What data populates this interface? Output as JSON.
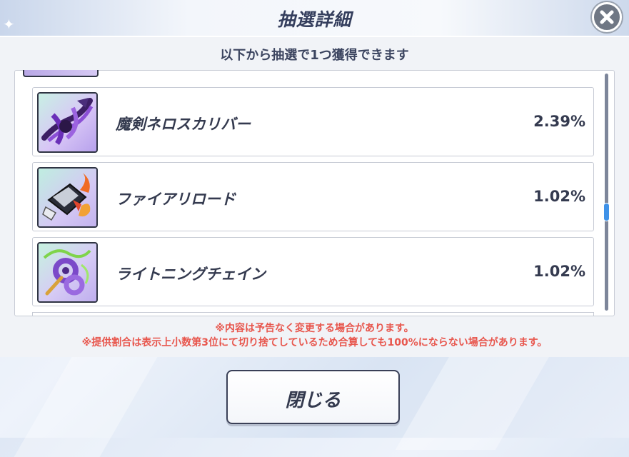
{
  "window": {
    "title": "抽選詳細",
    "close_icon": "close-x-icon"
  },
  "subtitle": "以下から抽選で1つ獲得できます",
  "items": [
    {
      "name": "魔剣ネロスカリバー",
      "rate": "2.39%",
      "icon": "purple-demon-sword-icon"
    },
    {
      "name": "ファイアリロード",
      "rate": "1.02%",
      "icon": "fire-gauntlet-icon"
    },
    {
      "name": "ライトニングチェイン",
      "rate": "1.02%",
      "icon": "lightning-chain-icon"
    }
  ],
  "notices": [
    "※内容は予告なく変更する場合があります。",
    "※提供割合は表示上小数第3位にて切り捨てしているため合算しても100%にならない場合があります。"
  ],
  "close_button_label": "閉じる",
  "colors": {
    "accent_text": "#343a4f",
    "notice_red": "#e8564d",
    "scroll_thumb": "#3f92e8"
  }
}
